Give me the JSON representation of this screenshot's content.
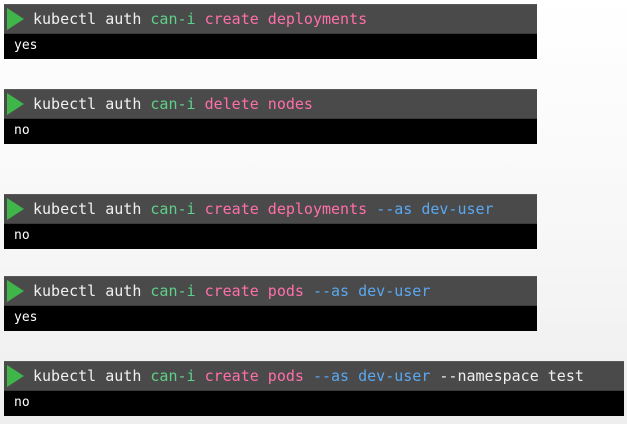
{
  "commands": [
    {
      "tokens": [
        {
          "text": "kubectl auth ",
          "kind": "base"
        },
        {
          "text": "can-i ",
          "kind": "verb"
        },
        {
          "text": "create deployments",
          "kind": "action"
        }
      ],
      "output": "yes"
    },
    {
      "tokens": [
        {
          "text": "kubectl auth ",
          "kind": "base"
        },
        {
          "text": "can-i ",
          "kind": "verb"
        },
        {
          "text": "delete nodes",
          "kind": "action"
        }
      ],
      "output": "no"
    },
    {
      "tokens": [
        {
          "text": "kubectl auth ",
          "kind": "base"
        },
        {
          "text": "can-i ",
          "kind": "verb"
        },
        {
          "text": "create deployments ",
          "kind": "action"
        },
        {
          "text": "--as dev-user",
          "kind": "flag"
        }
      ],
      "output": "no"
    },
    {
      "tokens": [
        {
          "text": "kubectl auth ",
          "kind": "base"
        },
        {
          "text": "can-i ",
          "kind": "verb"
        },
        {
          "text": "create pods ",
          "kind": "action"
        },
        {
          "text": "--as dev-user ",
          "kind": "flag"
        }
      ],
      "output": "yes"
    },
    {
      "tokens": [
        {
          "text": "kubectl auth ",
          "kind": "base"
        },
        {
          "text": "can-i ",
          "kind": "verb"
        },
        {
          "text": "create pods ",
          "kind": "action"
        },
        {
          "text": "--as dev-user ",
          "kind": "flag"
        },
        {
          "text": "--namespace test",
          "kind": "base"
        }
      ],
      "output": "no"
    }
  ],
  "icons": {
    "run": "play-icon"
  },
  "colors": {
    "command_bar": "#4a4a4a",
    "output_bar": "#000000",
    "play_icon": "#3fb54a",
    "base_text": "#f0f0f0",
    "verb": "#5fd08a",
    "action": "#ff6fa8",
    "flag": "#5aa8f0",
    "output_text": "#ffffff"
  }
}
